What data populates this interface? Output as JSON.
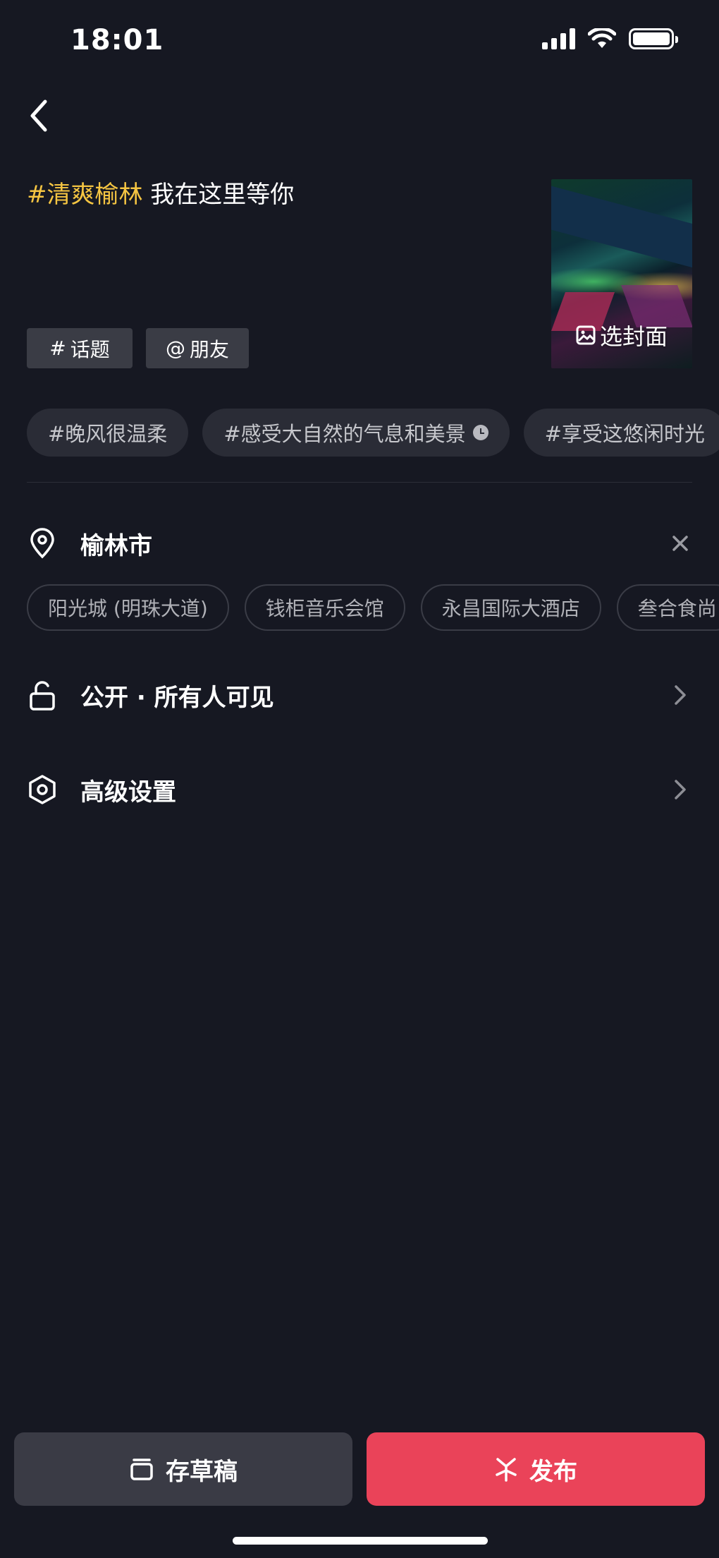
{
  "status_bar": {
    "time": "18:01"
  },
  "caption": {
    "hashtag": "#清爽榆林",
    "text": " 我在这里等你"
  },
  "tag_buttons": {
    "topic": "话题",
    "friend": "朋友",
    "topic_symbol": "#",
    "friend_symbol": "@"
  },
  "cover": {
    "label": "选封面"
  },
  "suggested_hashtags": [
    "#晚风很温柔",
    "#感受大自然的气息和美景",
    "#享受这悠闲时光"
  ],
  "location": {
    "city": "榆林市",
    "suggestions": [
      "阳光城 (明珠大道)",
      "钱柜音乐会馆",
      "永昌国际大酒店",
      "叁合食尚"
    ]
  },
  "visibility": {
    "label": "公开 · 所有人可见"
  },
  "advanced": {
    "label": "高级设置"
  },
  "actions": {
    "draft": "存草稿",
    "publish": "发布"
  },
  "colors": {
    "hashtag": "#f5c542",
    "publish": "#ea4359",
    "background": "#161822"
  }
}
